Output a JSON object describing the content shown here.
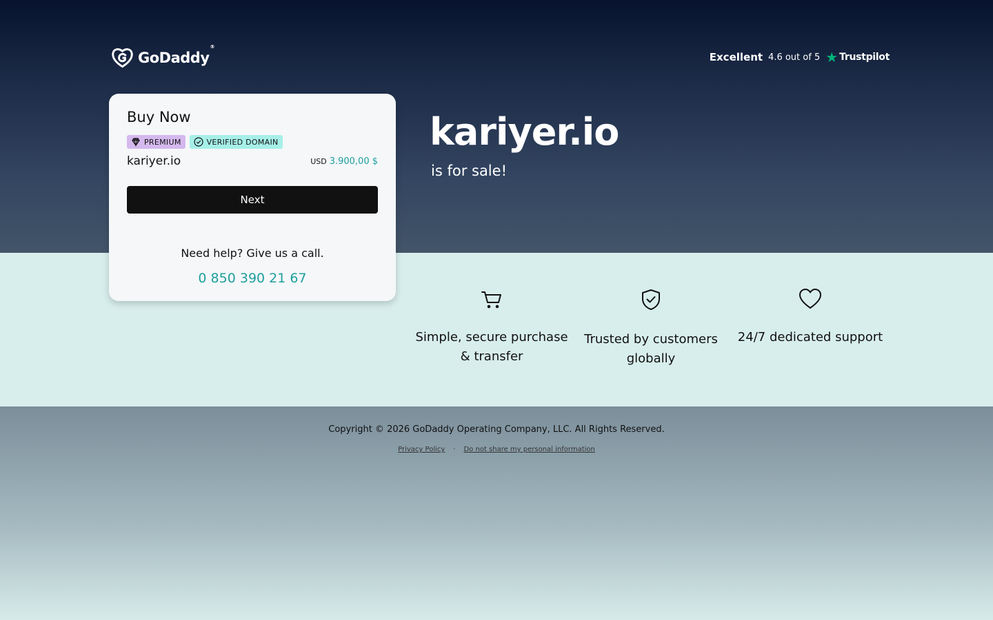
{
  "brand": {
    "name": "GoDaddy"
  },
  "rating": {
    "label": "Excellent",
    "score": "4.6 out of 5",
    "provider": "Trustpilot",
    "star_color": "#00b67a"
  },
  "card": {
    "title": "Buy Now",
    "badges": {
      "premium": "PREMIUM",
      "verified": "VERIFIED DOMAIN"
    },
    "domain": "kariyer.io",
    "currency": "USD",
    "price": "3.900,00 $",
    "next_label": "Next",
    "help_text": "Need help? Give us a call.",
    "phone": "0 850 390 21 67"
  },
  "hero": {
    "headline": "kariyer.io",
    "subhead": "is for sale!"
  },
  "features": [
    {
      "icon": "cart-icon",
      "text": "Simple, secure purchase & transfer"
    },
    {
      "icon": "shield-check-icon",
      "text": "Trusted by customers globally"
    },
    {
      "icon": "heart-icon",
      "text": "24/7 dedicated support"
    }
  ],
  "footer": {
    "copyright": "Copyright © 2026 GoDaddy Operating Company, LLC. All Rights Reserved.",
    "links": {
      "privacy": "Privacy Policy",
      "do_not_share": "Do not share my personal information"
    },
    "separator": "·"
  },
  "colors": {
    "accent": "#1f9e9e",
    "premium_badge": "#d4b8ee",
    "verified_badge": "#a6efe8",
    "button": "#111111"
  }
}
